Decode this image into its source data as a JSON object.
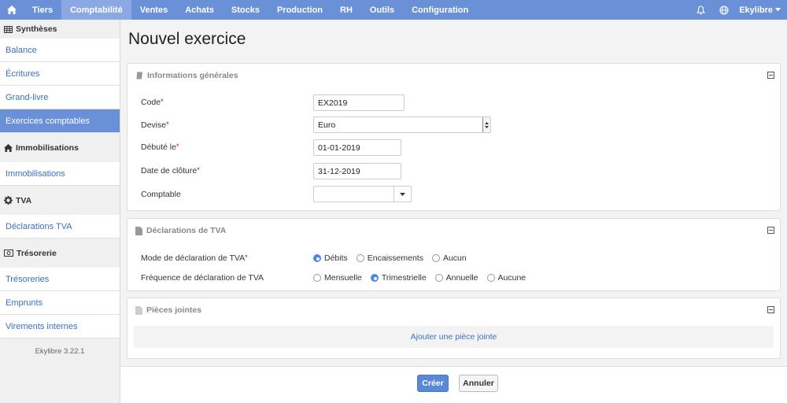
{
  "nav": {
    "items": [
      "Tiers",
      "Comptabilité",
      "Ventes",
      "Achats",
      "Stocks",
      "Production",
      "RH",
      "Outils",
      "Configuration"
    ],
    "active_index": 1,
    "user": "Ekylibre"
  },
  "sidebar": {
    "sections": [
      {
        "title": "Synthèses",
        "icon": "table-icon",
        "items": [
          "Balance",
          "Écritures",
          "Grand-livre",
          "Exercices comptables"
        ]
      },
      {
        "title": "Immobilisations",
        "icon": "home-icon",
        "items": [
          "Immobilisations"
        ]
      },
      {
        "title": "TVA",
        "icon": "gear-icon",
        "items": [
          "Déclarations TVA"
        ]
      },
      {
        "title": "Trésorerie",
        "icon": "money-icon",
        "items": [
          "Trésoreries",
          "Emprunts",
          "Virements internes"
        ]
      }
    ],
    "active_item": "Exercices comptables",
    "version": "Ekylibre 3.22.1"
  },
  "page": {
    "title": "Nouvel exercice"
  },
  "general": {
    "header": "Informations générales",
    "code_label": "Code",
    "code_value": "EX2019",
    "currency_label": "Devise",
    "currency_value": "Euro",
    "start_label": "Débuté le",
    "start_value": "01-01-2019",
    "end_label": "Date de clôture",
    "end_value": "31-12-2019",
    "accountant_label": "Comptable",
    "accountant_value": ""
  },
  "vat": {
    "header": "Déclarations de TVA",
    "mode_label": "Mode de déclaration de TVA",
    "mode_options": [
      "Débits",
      "Encaissements",
      "Aucun"
    ],
    "mode_selected": "Débits",
    "frequency_label": "Fréquence de déclaration de TVA",
    "frequency_options": [
      "Mensuelle",
      "Trimestrielle",
      "Annuelle",
      "Aucune"
    ],
    "frequency_selected": "Trimestrielle"
  },
  "attachments": {
    "header": "Pièces jointes",
    "add_label": "Ajouter une pièce jointe"
  },
  "actions": {
    "create": "Créer",
    "cancel": "Annuler"
  }
}
